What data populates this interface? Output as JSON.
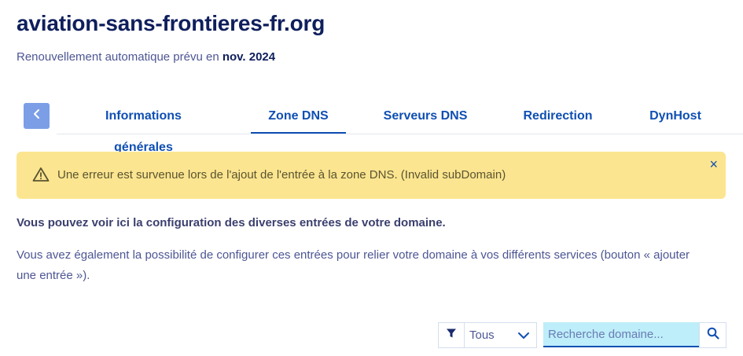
{
  "header": {
    "domain": "aviation-sans-frontieres-fr.org",
    "renewal_prefix": "Renouvellement automatique prévu en",
    "renewal_date": "nov. 2024"
  },
  "tabs": [
    {
      "label": "Informations générales",
      "active": false
    },
    {
      "label": "Zone DNS",
      "active": true
    },
    {
      "label": "Serveurs DNS",
      "active": false
    },
    {
      "label": "Redirection",
      "active": false
    },
    {
      "label": "DynHost",
      "active": false
    }
  ],
  "alert": {
    "message": "Une erreur est survenue lors de l'ajout de l'entrée à la zone DNS. (Invalid subDomain)",
    "close_label": "×"
  },
  "content": {
    "intro": "Vous pouvez voir ici la configuration des diverses entrées de votre domaine.",
    "description": "Vous avez également la possibilité de configurer ces entrées pour relier votre domaine à vos différents services (bouton « ajouter une entrée »)."
  },
  "filter": {
    "selected": "Tous"
  },
  "search": {
    "placeholder": "Recherche domaine..."
  },
  "colors": {
    "primary": "#0f4fb3",
    "title": "#0f1f5c",
    "alert_bg": "#fbe590",
    "back_button": "#7b9ee6",
    "search_bg": "#bdeef9"
  },
  "icons": {
    "back": "chevron-left-icon",
    "warning": "warning-icon",
    "close": "close-icon",
    "filter": "filter-icon",
    "dropdown": "chevron-down-icon",
    "search": "search-icon"
  }
}
